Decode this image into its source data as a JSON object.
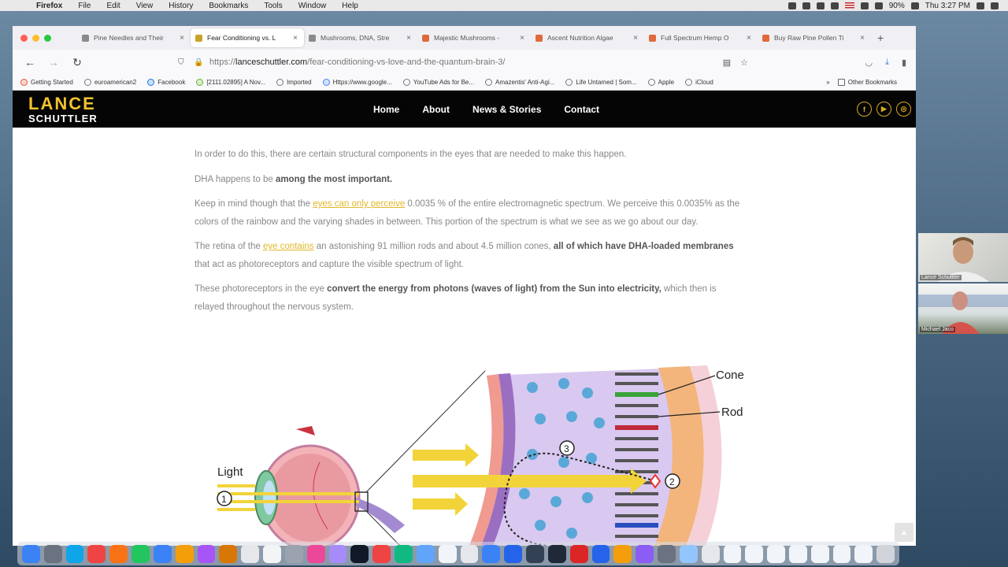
{
  "menubar": {
    "apple": "",
    "items": [
      "Firefox",
      "File",
      "Edit",
      "View",
      "History",
      "Bookmarks",
      "Tools",
      "Window",
      "Help"
    ],
    "battery": "90%",
    "clock": "Thu 3:27 PM"
  },
  "tabs": [
    {
      "title": "Pine Needles and Their",
      "color": "#8a8a8a",
      "active": false
    },
    {
      "title": "Fear Conditioning vs. L",
      "color": "#c9a227",
      "active": true
    },
    {
      "title": "Mushrooms, DNA, Stre",
      "color": "#8a8a8a",
      "active": false
    },
    {
      "title": "Majestic Mushrooms -",
      "color": "#e06a3a",
      "active": false
    },
    {
      "title": "Ascent Nutrition Algae",
      "color": "#e06a3a",
      "active": false
    },
    {
      "title": "Full Spectrum Hemp O",
      "color": "#e06a3a",
      "active": false
    },
    {
      "title": "Buy Raw Pine Pollen Ti",
      "color": "#e06a3a",
      "active": false
    }
  ],
  "tab_close": "×",
  "newtab": "+",
  "nav": {
    "back": "←",
    "forward": "→",
    "reload": "↻"
  },
  "url": {
    "scheme": "https://",
    "host": "lanceschuttler.com",
    "path": "/fear-conditioning-vs-love-and-the-quantum-brain-3/"
  },
  "bookmarks": [
    {
      "label": "Getting Started",
      "color": "#e8572a"
    },
    {
      "label": "euroamerican2",
      "color": "#777"
    },
    {
      "label": "Facebook",
      "color": "#1877f2"
    },
    {
      "label": "[2111.02895] A Nov...",
      "color": "#6bb324"
    },
    {
      "label": "Imported",
      "color": "#777"
    },
    {
      "label": "Https://www.google...",
      "color": "#4285f4"
    },
    {
      "label": "YouTube Ads for Be...",
      "color": "#777"
    },
    {
      "label": "Amazentis' Anti-Agi...",
      "color": "#777"
    },
    {
      "label": "Life Untamed | Som...",
      "color": "#777"
    },
    {
      "label": "Apple",
      "color": "#777"
    },
    {
      "label": "iCloud",
      "color": "#777"
    }
  ],
  "bookmarks_more": "»",
  "bookmarks_other": "Other Bookmarks",
  "site": {
    "logo_line1": "LANCE",
    "logo_line2": "SCHUTTLER",
    "nav": [
      "Home",
      "About",
      "News & Stories",
      "Contact"
    ],
    "social": [
      "f",
      "▶",
      "◎"
    ]
  },
  "article": {
    "p1": "In order to do this, there are certain structural components in the eyes that are needed to make this happen.",
    "p2_a": "DHA happens to be ",
    "p2_b": "among the most important.",
    "p3_a": "Keep in mind though that the ",
    "p3_link": "eyes can only perceive",
    "p3_b": " 0.0035 % of the entire electromagnetic spectrum. We perceive this 0.0035% as the colors of the rainbow and the varying shades in between. This portion of the spectrum is what we see as we go about our day.",
    "p4_a": "The retina of the ",
    "p4_link": "eye contains",
    "p4_b": " an astonishing 91 million rods and about 4.5 million cones, ",
    "p4_bold": "all of which have DHA-loaded membranes",
    "p4_c": " that act as photoreceptors and capture the visible spectrum of light.",
    "p5_a": "These photoreceptors in the eye ",
    "p5_bold": "convert the energy from photons (waves of light) from the Sun into electricity,",
    "p5_b": " which then is relayed throughout the nervous system."
  },
  "diagram": {
    "label_light": "Light",
    "label_cone": "Cone",
    "label_rod": "Rod",
    "step1": "1",
    "step2": "2",
    "step3": "3"
  },
  "participants": [
    {
      "name": "Lance Schuttler"
    },
    {
      "name": "Michael Jaco"
    }
  ],
  "scrolltop": "▲"
}
